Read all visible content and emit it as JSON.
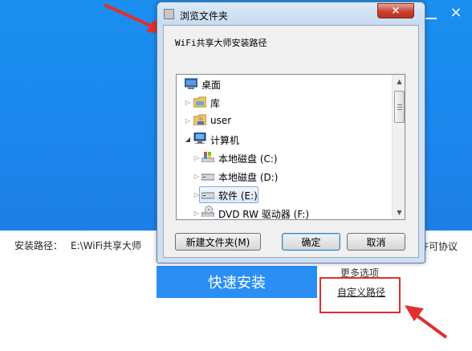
{
  "installer": {
    "path_label": "安装路径：",
    "path_value": "E:\\WiFi共享大师",
    "license_fragment": "许可协议",
    "install_button": "快速安装",
    "more_options": "更多选项",
    "custom_path": "自定义路径",
    "close_symbol": "×"
  },
  "dialog": {
    "title": "浏览文件夹",
    "close_symbol": "×",
    "description": "WiFi共享大师安装路径",
    "tree": [
      {
        "label": "桌面",
        "icon": "desktop-icon"
      },
      {
        "label": "库",
        "icon": "library-folder-icon"
      },
      {
        "label": "user",
        "icon": "user-folder-icon"
      },
      {
        "label": "计算机",
        "icon": "computer-icon"
      },
      {
        "label": "本地磁盘 (C:)",
        "icon": "system-drive-icon"
      },
      {
        "label": "本地磁盘 (D:)",
        "icon": "hard-drive-icon"
      },
      {
        "label": "软件 (E:)",
        "icon": "hard-drive-icon",
        "selected": true
      },
      {
        "label": "DVD RW 驱动器 (F:)",
        "icon": "dvd-drive-icon"
      }
    ],
    "buttons": {
      "new_folder": "新建文件夹(M)",
      "ok": "确定",
      "cancel": "取消"
    }
  },
  "colors": {
    "installer_blue": "#1b86ec",
    "install_button": "#2a8ef5",
    "annotation_red": "#e03030"
  }
}
